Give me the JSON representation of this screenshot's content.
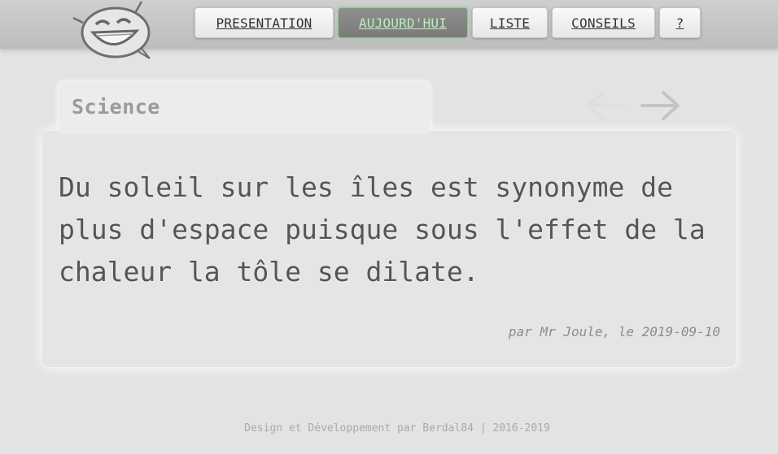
{
  "nav": {
    "items": [
      {
        "label": "PRESENTATION",
        "active": false
      },
      {
        "label": "AUJOURD'HUI",
        "active": true
      },
      {
        "label": "LISTE",
        "active": false
      },
      {
        "label": "CONSEILS",
        "active": false
      },
      {
        "label": "?",
        "active": false
      }
    ]
  },
  "logo": {
    "icon": "smiley-speech-bubble-icon"
  },
  "category": {
    "label": "Science"
  },
  "arrows": {
    "previous": {
      "icon": "arrow-left-icon",
      "enabled": false
    },
    "next": {
      "icon": "arrow-right-icon",
      "enabled": true
    }
  },
  "quote": {
    "text": "Du soleil sur les îles est synonyme de plus d'espace puisque sous l'effet de la chaleur la tôle se dilate.",
    "attribution": "par Mr Joule, le 2019-09-10"
  },
  "footer": {
    "text": "Design et Développement par Berdal84 | 2016-2019"
  },
  "colors": {
    "background": "#e3e3e3",
    "active_nav_bg": "#858585",
    "active_nav_text": "#b8f0b8",
    "quote_text": "#555555"
  }
}
